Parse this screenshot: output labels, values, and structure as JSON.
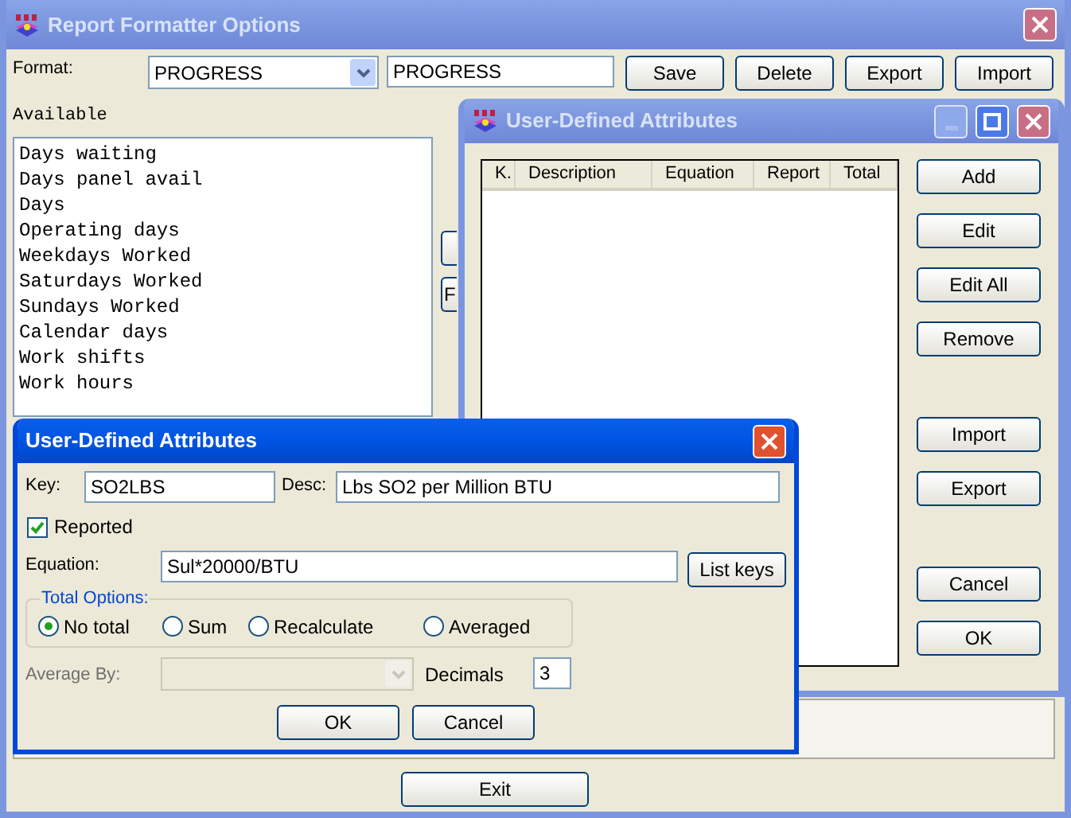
{
  "main_window": {
    "title": "Report Formatter Options",
    "active": false,
    "format_label": "Format:",
    "format_combo": "PROGRESS",
    "format_name": "PROGRESS",
    "buttons": [
      "Save",
      "Delete",
      "Export",
      "Import"
    ],
    "available_label": "Available",
    "available_items": [
      "Days waiting",
      "Days panel avail",
      "Days",
      "Operating days",
      "Weekdays Worked",
      "Saturdays Worked",
      "Sundays Worked",
      "Calendar days",
      "Work shifts",
      "Work hours"
    ],
    "partial_button_label": "F",
    "exit_button": "Exit"
  },
  "attributes_window": {
    "title": "User-Defined Attributes",
    "active": false,
    "columns": [
      "K.",
      "Description",
      "Equation",
      "Report",
      "Total"
    ],
    "button_groups": [
      [
        "Add",
        "Edit",
        "Edit All",
        "Remove"
      ],
      [
        "Import",
        "Export"
      ],
      [
        "Cancel",
        "OK"
      ]
    ]
  },
  "edit_dialog": {
    "title": "User-Defined Attributes",
    "active": true,
    "key_label": "Key:",
    "key": "SO2LBS",
    "desc_label": "Desc:",
    "desc": "Lbs SO2 per Million BTU",
    "reported": {
      "label": "Reported",
      "checked": true
    },
    "equation_label": "Equation:",
    "equation": "Sul*20000/BTU",
    "list_keys_button": "List keys",
    "total_options": {
      "legend": "Total Options:",
      "options": [
        {
          "label": "No total",
          "selected": true
        },
        {
          "label": "Sum",
          "selected": false
        },
        {
          "label": "Recalculate",
          "selected": false
        },
        {
          "label": "Averaged",
          "selected": false
        }
      ]
    },
    "average_by_label": "Average By:",
    "average_by_disabled": true,
    "decimals_label": "Decimals",
    "decimals": "3",
    "buttons": [
      "OK",
      "Cancel"
    ]
  }
}
